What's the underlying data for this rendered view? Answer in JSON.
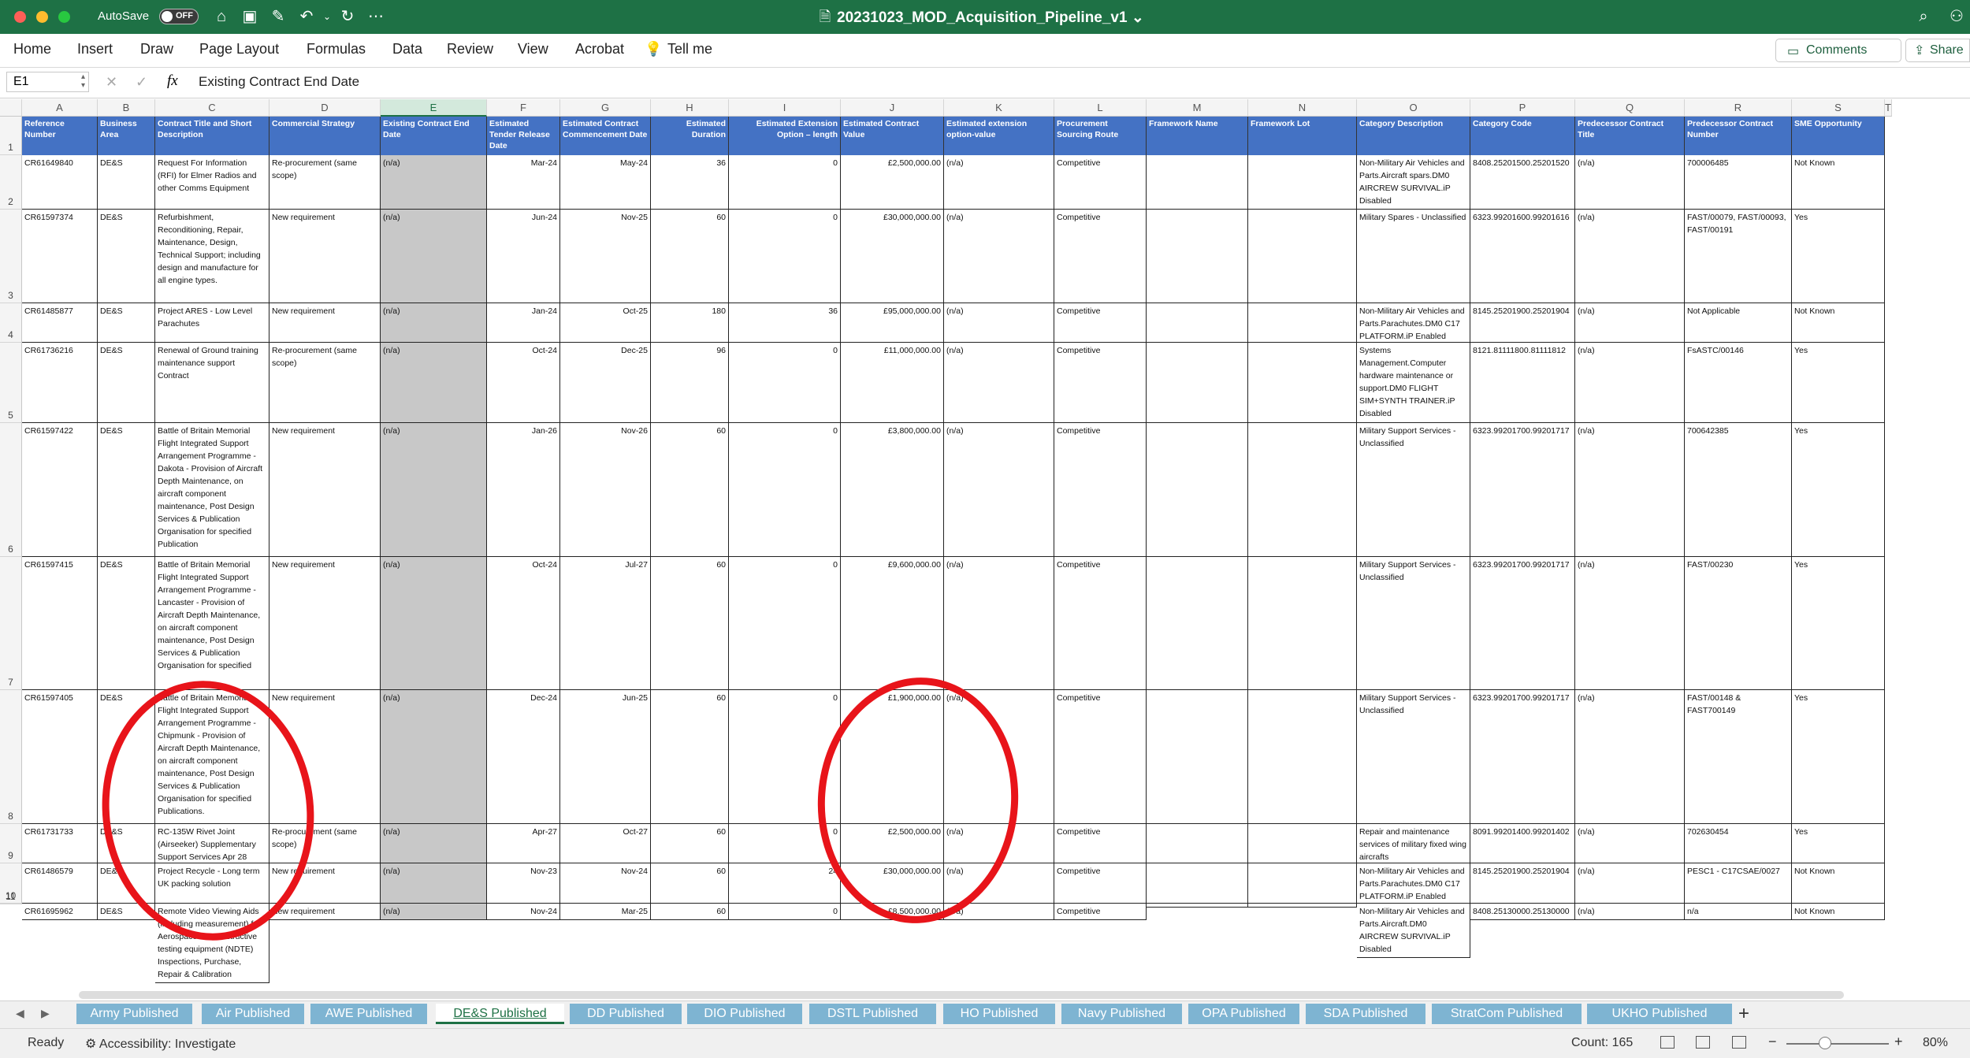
{
  "window": {
    "title": "20231023_MOD_Acquisition_Pipeline_v1",
    "autosave_label": "AutoSave",
    "autosave_state": "OFF"
  },
  "ribbon": {
    "tabs": [
      "Home",
      "Insert",
      "Draw",
      "Page Layout",
      "Formulas",
      "Data",
      "Review",
      "View",
      "Acrobat",
      "Tell me"
    ],
    "comments_label": "Comments",
    "share_label": "Share"
  },
  "formula_bar": {
    "cell_ref": "E1",
    "fx": "fx",
    "content": "Existing Contract End Date"
  },
  "columns": [
    "A",
    "B",
    "C",
    "D",
    "E",
    "F",
    "G",
    "H",
    "I",
    "J",
    "K",
    "L",
    "M",
    "N",
    "O",
    "P",
    "Q",
    "R",
    "S",
    "T"
  ],
  "selected_column": "E",
  "headers": [
    "Reference Number",
    "Business Area",
    "Contract Title and Short Description",
    "Commercial Strategy",
    "Existing Contract End Date",
    "Estimated Tender Release Date",
    "Estimated Contract Commencement Date",
    "Estimated Duration",
    "Estimated Extension Option – length",
    "Estimated Contract Value",
    "Estimated extension option-value",
    "Procurement Sourcing Route",
    "Framework Name",
    "Framework Lot",
    "Category Description",
    "Category Code",
    "Predecessor Contract Title",
    "Predecessor Contract Number",
    "SME Opportunity"
  ],
  "rows": [
    {
      "num": "2",
      "cells": [
        "CR61649840",
        "DE&S",
        "Request For Information (RFI) for Elmer Radios and other Comms Equipment",
        "Re-procurement (same scope)",
        "(n/a)",
        "Mar-24",
        "May-24",
        "36",
        "0",
        "£2,500,000.00",
        "(n/a)",
        "Competitive",
        "",
        "",
        "Non-Military Air Vehicles and Parts.Aircraft spars.DM0 AIRCREW SURVIVAL.iP Disabled",
        "8408.25201500.25201520",
        "(n/a)",
        "700006485",
        "Not Known"
      ]
    },
    {
      "num": "3",
      "cells": [
        "CR61597374",
        "DE&S",
        "Refurbishment, Reconditioning, Repair, Maintenance, Design, Technical Support; including design and manufacture for all engine types.",
        "New requirement",
        "(n/a)",
        "Jun-24",
        "Nov-25",
        "60",
        "0",
        "£30,000,000.00",
        "(n/a)",
        "Competitive",
        "",
        "",
        "Military Spares - Unclassified",
        "6323.99201600.99201616",
        "(n/a)",
        "FAST/00079, FAST/00093, FAST/00191",
        "Yes"
      ]
    },
    {
      "num": "4",
      "cells": [
        "CR61485877",
        "DE&S",
        "Project ARES - Low Level Parachutes",
        "New requirement",
        "(n/a)",
        "Jan-24",
        "Oct-25",
        "180",
        "36",
        "£95,000,000.00",
        "(n/a)",
        "Competitive",
        "",
        "",
        "Non-Military Air Vehicles and Parts.Parachutes.DM0 C17 PLATFORM.iP Enabled",
        "8145.25201900.25201904",
        "(n/a)",
        "Not Applicable",
        "Not Known"
      ]
    },
    {
      "num": "5",
      "cells": [
        "CR61736216",
        "DE&S",
        "Renewal of Ground training maintenance support Contract",
        "Re-procurement (same scope)",
        "(n/a)",
        "Oct-24",
        "Dec-25",
        "96",
        "0",
        "£11,000,000.00",
        "(n/a)",
        "Competitive",
        "",
        "",
        "Systems Management.Computer hardware maintenance or support.DM0 FLIGHT SIM+SYNTH TRAINER.iP Disabled",
        "8121.81111800.81111812",
        "(n/a)",
        "FsASTC/00146",
        "Yes"
      ]
    },
    {
      "num": "6",
      "cells": [
        "CR61597422",
        "DE&S",
        "Battle of Britain Memorial Flight Integrated Support Arrangement Programme - Dakota - Provision of Aircraft Depth Maintenance, on aircraft component maintenance, Post Design Services & Publication Organisation for specified Publication",
        "New requirement",
        "(n/a)",
        "Jan-26",
        "Nov-26",
        "60",
        "0",
        "£3,800,000.00",
        "(n/a)",
        "Competitive",
        "",
        "",
        "Military Support Services - Unclassified",
        "6323.99201700.99201717",
        "(n/a)",
        "700642385",
        "Yes"
      ]
    },
    {
      "num": "7",
      "cells": [
        "CR61597415",
        "DE&S",
        "Battle of Britain Memorial Flight Integrated Support Arrangement Programme - Lancaster - Provision of Aircraft Depth Maintenance, on aircraft component maintenance, Post Design Services & Publication Organisation for specified",
        "New requirement",
        "(n/a)",
        "Oct-24",
        "Jul-27",
        "60",
        "0",
        "£9,600,000.00",
        "(n/a)",
        "Competitive",
        "",
        "",
        "Military Support Services - Unclassified",
        "6323.99201700.99201717",
        "(n/a)",
        "FAST/00230",
        "Yes"
      ]
    },
    {
      "num": "8",
      "cells": [
        "CR61597405",
        "DE&S",
        "Battle of Britain Memorial Flight Integrated Support Arrangement Programme - Chipmunk - Provision of Aircraft Depth Maintenance, on aircraft component maintenance, Post Design Services & Publication Organisation for specified Publications.",
        "New requirement",
        "(n/a)",
        "Dec-24",
        "Jun-25",
        "60",
        "0",
        "£1,900,000.00",
        "(n/a)",
        "Competitive",
        "",
        "",
        "Military Support Services - Unclassified",
        "6323.99201700.99201717",
        "(n/a)",
        "FAST/00148 & FAST700149",
        "Yes"
      ]
    },
    {
      "num": "9",
      "cells": [
        "CR61731733",
        "DE&S",
        "RC-135W Rivet Joint (Airseeker) Supplementary Support Services Apr 28",
        "Re-procurement (same scope)",
        "(n/a)",
        "Apr-27",
        "Oct-27",
        "60",
        "0",
        "£2,500,000.00",
        "(n/a)",
        "Competitive",
        "",
        "",
        "Repair and maintenance services of military fixed wing aircrafts",
        "8091.99201400.99201402",
        "(n/a)",
        "702630454",
        "Yes"
      ]
    },
    {
      "num": "10",
      "cells": [
        "CR61486579",
        "DE&S",
        "Project Recycle - Long term UK packing solution",
        "New requirement",
        "(n/a)",
        "Nov-23",
        "Nov-24",
        "60",
        "24",
        "£30,000,000.00",
        "(n/a)",
        "Competitive",
        "",
        "",
        "Non-Military Air Vehicles and Parts.Parachutes.DM0 C17 PLATFORM.iP Enabled",
        "8145.25201900.25201904",
        "(n/a)",
        "PESC1 - C17CSAE/0027",
        "Not Known"
      ]
    },
    {
      "num": "11",
      "cells": [
        "CR61695962",
        "DE&S",
        "Remote Video Viewing Aids (including measurement) for Aerospace Non destructive testing equipment (NDTE) Inspections, Purchase, Repair & Calibration",
        "New requirement",
        "(n/a)",
        "Nov-24",
        "Mar-25",
        "60",
        "0",
        "£8,500,000.00",
        "(n/a)",
        "Competitive",
        "",
        "",
        "Non-Military Air Vehicles and Parts.Aircraft.DM0 AIRCREW SURVIVAL.iP Disabled",
        "8408.25130000.25130000",
        "(n/a)",
        "n/a",
        "Not Known"
      ]
    }
  ],
  "sheet_tabs": [
    "Army Published",
    "Air Published",
    "AWE Published",
    "DE&S Published",
    "DD Published",
    "DIO Published",
    "DSTL Published",
    "HO Published",
    "Navy Published",
    "OPA Published",
    "SDA Published",
    "StratCom Published",
    "UKHO Published"
  ],
  "active_sheet": "DE&S Published",
  "status": {
    "ready": "Ready",
    "accessibility": "Accessibility: Investigate",
    "count": "Count: 165",
    "zoom": "80%"
  },
  "colors": {
    "title_bar": "#1e7145",
    "header_fill": "#4472c4",
    "sheet_tab": "#7eb4d2",
    "annotation": "#e8141a",
    "grey_column": "#c8c8c8"
  }
}
